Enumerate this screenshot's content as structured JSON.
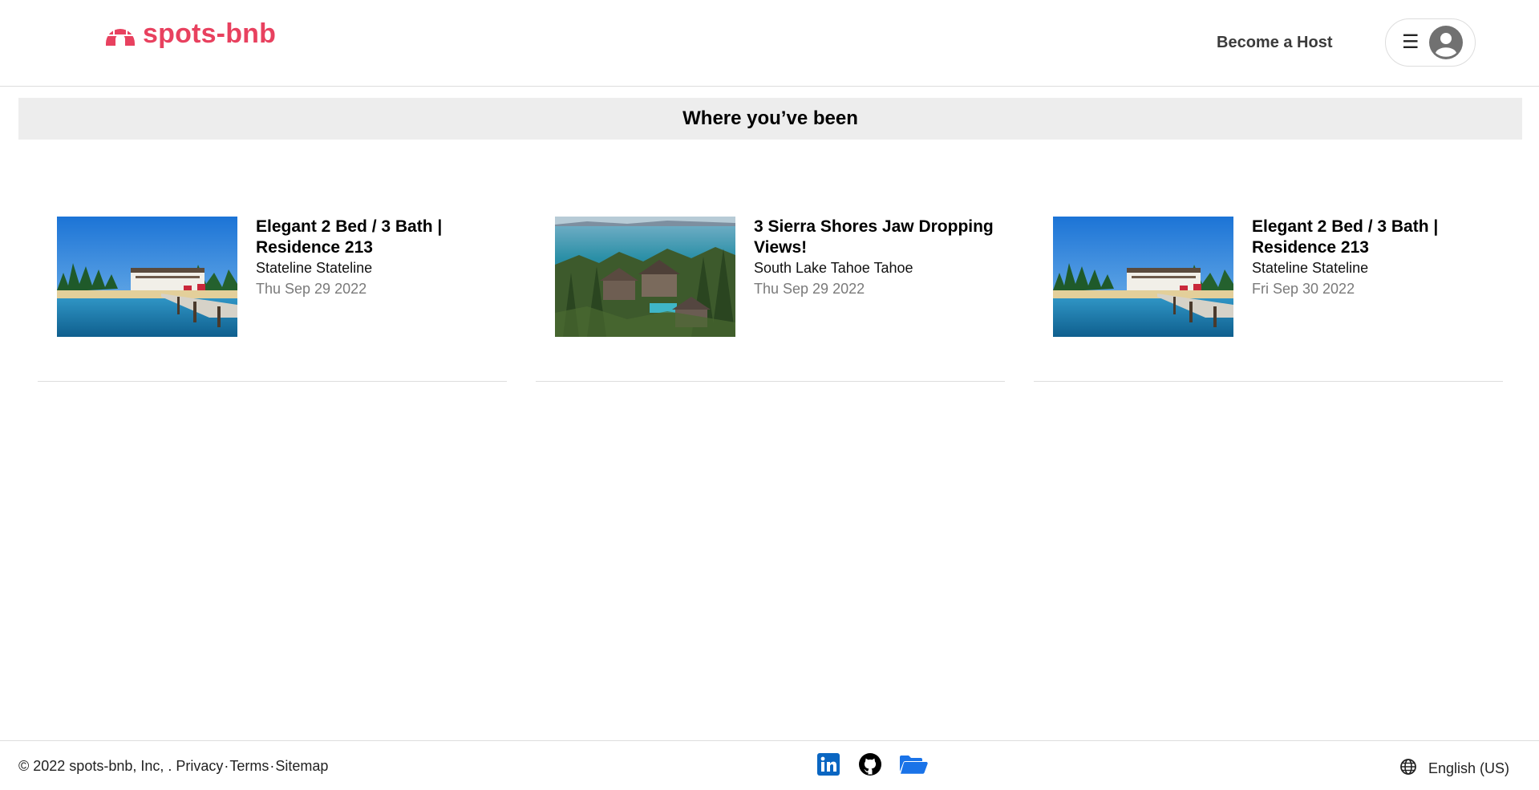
{
  "header": {
    "logo_text": "spots-bnb",
    "become_host": "Become a Host",
    "menu_icon": "☰"
  },
  "page": {
    "title": "Where you’ve been"
  },
  "trips": [
    {
      "name": "Elegant 2 Bed / 3 Bath | Residence 213",
      "location": "Stateline Stateline",
      "date": "Thu Sep 29 2022",
      "image": "lake-pier-image"
    },
    {
      "name": "3 Sierra Shores Jaw Dropping Views!",
      "location": "South Lake Tahoe Tahoe",
      "date": "Thu Sep 29 2022",
      "image": "aerial-forest-lake-image"
    },
    {
      "name": "Elegant 2 Bed / 3 Bath | Residence 213",
      "location": "Stateline Stateline",
      "date": "Fri Sep 30 2022",
      "image": "lake-pier-image"
    }
  ],
  "footer": {
    "copyright": "© 2022 spots-bnb, Inc, .",
    "privacy": "Privacy",
    "terms": "Terms",
    "sitemap": "Sitemap",
    "separator": "·",
    "language": "English (US)",
    "icons": [
      "linkedin-icon",
      "github-icon",
      "folder-icon",
      "globe-icon"
    ]
  },
  "colors": {
    "brand": "#e8415f",
    "title_bar_bg": "#ededed",
    "date_text": "#7a7a7a",
    "linkedin": "#0a66c2",
    "folder": "#1a73e8"
  }
}
